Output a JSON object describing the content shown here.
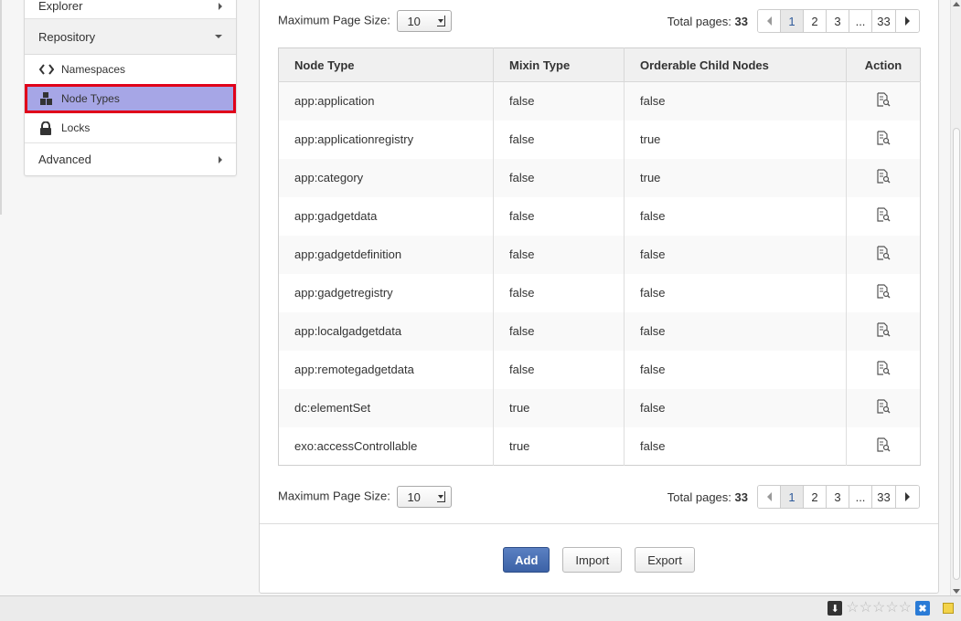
{
  "sidebar": {
    "explorer_label": "Explorer",
    "repository_label": "Repository",
    "items": [
      {
        "label": "Namespaces",
        "icon": "code-icon"
      },
      {
        "label": "Node Types",
        "icon": "node-types-icon"
      },
      {
        "label": "Locks",
        "icon": "lock-icon"
      }
    ],
    "advanced_label": "Advanced"
  },
  "pager": {
    "max_page_size_label": "Maximum Page Size:",
    "page_size_value": "10",
    "total_pages_label": "Total pages:",
    "total_pages_value": "33",
    "pages": [
      "1",
      "2",
      "3",
      "...",
      "33"
    ],
    "current_page": "1"
  },
  "table": {
    "headers": [
      "Node Type",
      "Mixin Type",
      "Orderable Child Nodes",
      "Action"
    ],
    "rows": [
      [
        "app:application",
        "false",
        "false"
      ],
      [
        "app:applicationregistry",
        "false",
        "true"
      ],
      [
        "app:category",
        "false",
        "true"
      ],
      [
        "app:gadgetdata",
        "false",
        "false"
      ],
      [
        "app:gadgetdefinition",
        "false",
        "false"
      ],
      [
        "app:gadgetregistry",
        "false",
        "false"
      ],
      [
        "app:localgadgetdata",
        "false",
        "false"
      ],
      [
        "app:remotegadgetdata",
        "false",
        "false"
      ],
      [
        "dc:elementSet",
        "true",
        "false"
      ],
      [
        "exo:accessControllable",
        "true",
        "false"
      ]
    ]
  },
  "buttons": {
    "add": "Add",
    "import": "Import",
    "export": "Export"
  },
  "colors": {
    "highlight_bg": "#a6a6e6",
    "highlight_border": "#e0001a",
    "primary_button": "#4a6fb3"
  }
}
